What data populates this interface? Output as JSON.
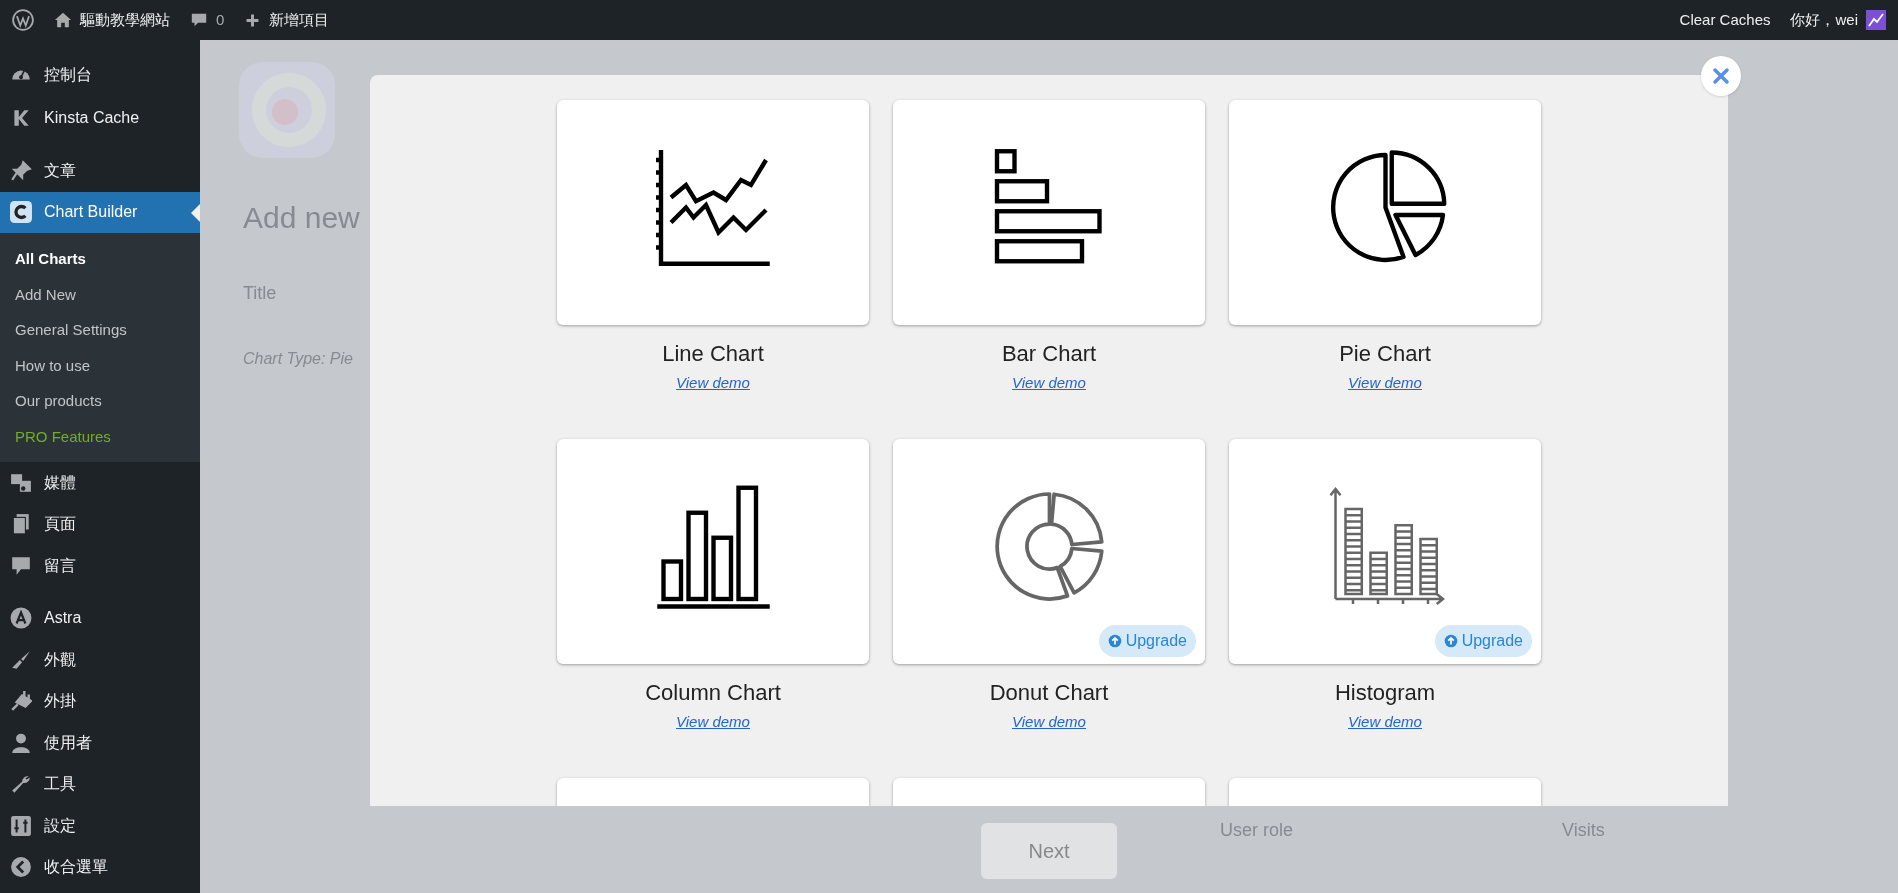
{
  "top_bar": {
    "site_name": "驅動教學網站",
    "comments": "0",
    "new_item": "新增項目",
    "clear_caches": "Clear Caches",
    "greeting": "你好，wei"
  },
  "sidebar": {
    "items": [
      {
        "label": "控制台",
        "selected": false
      },
      {
        "label": "Kinsta Cache",
        "selected": false
      },
      {
        "label": "文章",
        "selected": false
      },
      {
        "label": "Chart Builder",
        "selected": true,
        "children": [
          {
            "label": "All Charts",
            "selected": true,
            "kind": "link"
          },
          {
            "label": "Add New",
            "selected": false,
            "kind": "link"
          },
          {
            "label": "General Settings",
            "selected": false,
            "kind": "link"
          },
          {
            "label": "How to use",
            "selected": false,
            "kind": "link"
          },
          {
            "label": "Our products",
            "selected": false,
            "kind": "link"
          },
          {
            "label": "PRO Features",
            "selected": false,
            "kind": "pro"
          }
        ]
      },
      {
        "label": "媒體",
        "selected": false
      },
      {
        "label": "頁面",
        "selected": false
      },
      {
        "label": "留言",
        "selected": false
      },
      {
        "label": "Astra",
        "selected": false
      },
      {
        "label": "外觀",
        "selected": false
      },
      {
        "label": "外掛",
        "selected": false
      },
      {
        "label": "使用者",
        "selected": false
      },
      {
        "label": "工具",
        "selected": false
      },
      {
        "label": "設定",
        "selected": false
      },
      {
        "label": "收合選單",
        "selected": false
      }
    ]
  },
  "background": {
    "heading": "Add new",
    "field_label": "Title",
    "chart_type": "Chart Type: Pie",
    "table_headers": [
      "User role",
      "Visits"
    ]
  },
  "modal": {
    "chart_types": [
      {
        "kind": "line",
        "name": "Line Chart",
        "link": "View demo"
      },
      {
        "kind": "bar",
        "name": "Bar Chart",
        "link": "View demo"
      },
      {
        "kind": "pie",
        "name": "Pie Chart",
        "link": "View demo"
      },
      {
        "kind": "column",
        "name": "Column Chart",
        "link": "View demo"
      },
      {
        "kind": "donut",
        "name": "Donut Chart",
        "link": "View demo",
        "badge": "Upgrade"
      },
      {
        "kind": "histogram",
        "name": "Histogram",
        "link": "View demo",
        "badge": "Upgrade"
      },
      {
        "kind": "partial"
      },
      {
        "kind": "partial"
      },
      {
        "kind": "partial"
      }
    ]
  },
  "footer": {
    "next_button": {
      "label": "Next",
      "disabled": true
    }
  }
}
